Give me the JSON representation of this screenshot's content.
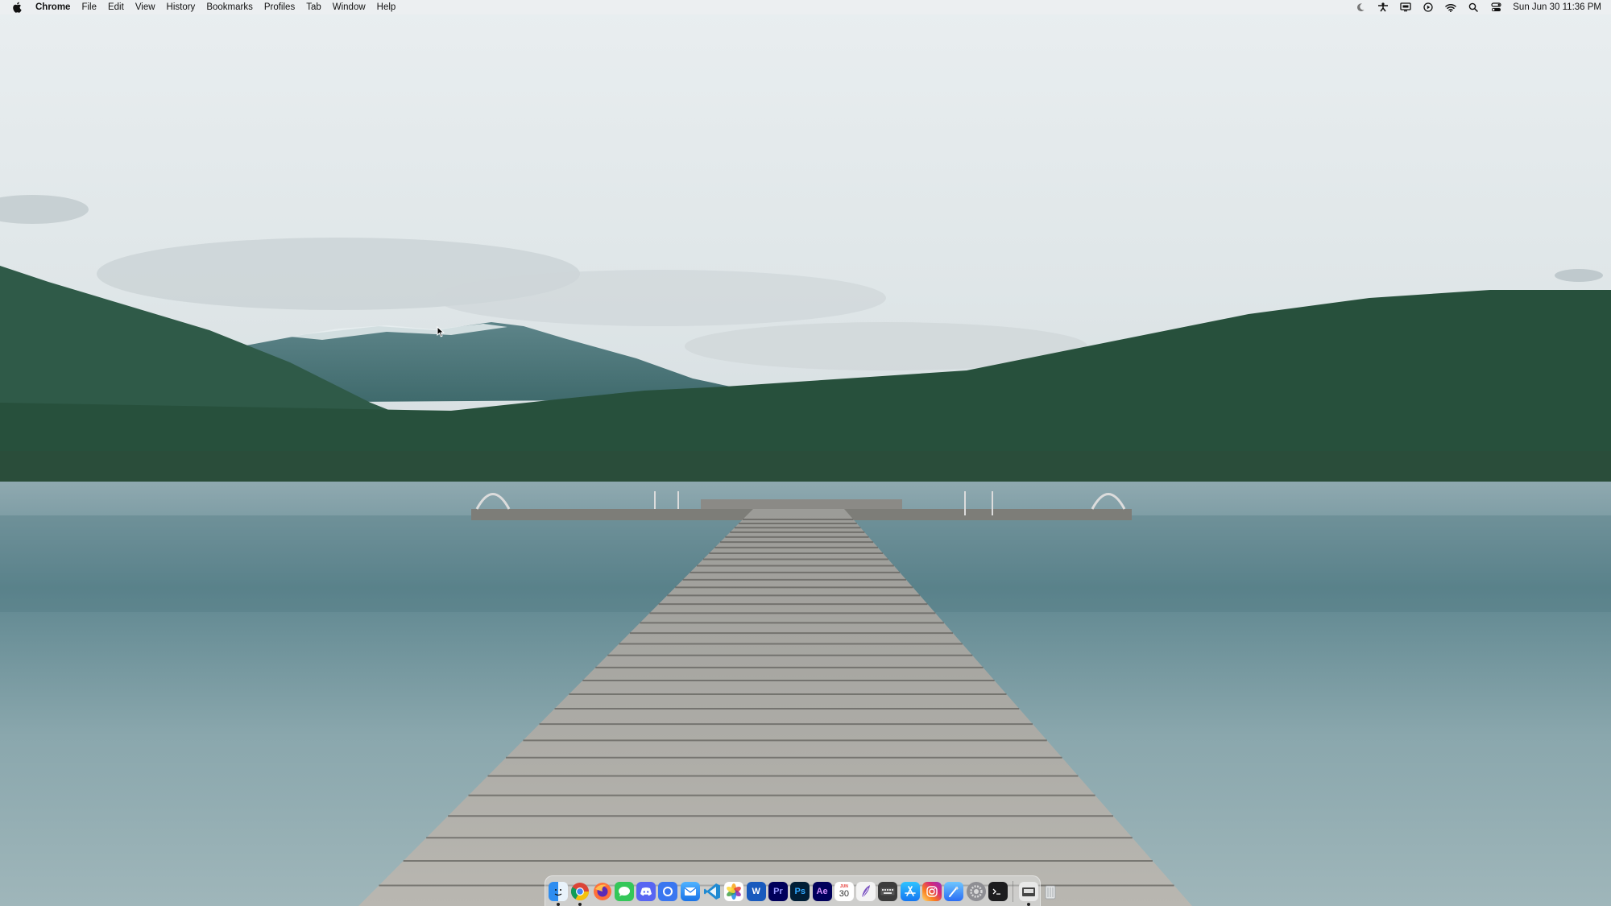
{
  "menubar": {
    "app_name": "Chrome",
    "items": [
      "File",
      "Edit",
      "View",
      "History",
      "Bookmarks",
      "Profiles",
      "Tab",
      "Window",
      "Help"
    ],
    "status_icons": [
      "moon-icon",
      "figure-icon",
      "screen-mirroring-icon",
      "play-circle-icon",
      "wifi-icon",
      "spotlight-search-icon",
      "control-center-icon"
    ],
    "clock": "Sun Jun 30  11:36 PM"
  },
  "dock": {
    "calendar_month": "JUN",
    "calendar_day": "30",
    "premiere_label": "Pr",
    "photoshop_label": "Ps",
    "after_effects_label": "Ae",
    "word_label": "W"
  },
  "wallpaper": {
    "description_icon": "lake-dock-wallpaper"
  }
}
